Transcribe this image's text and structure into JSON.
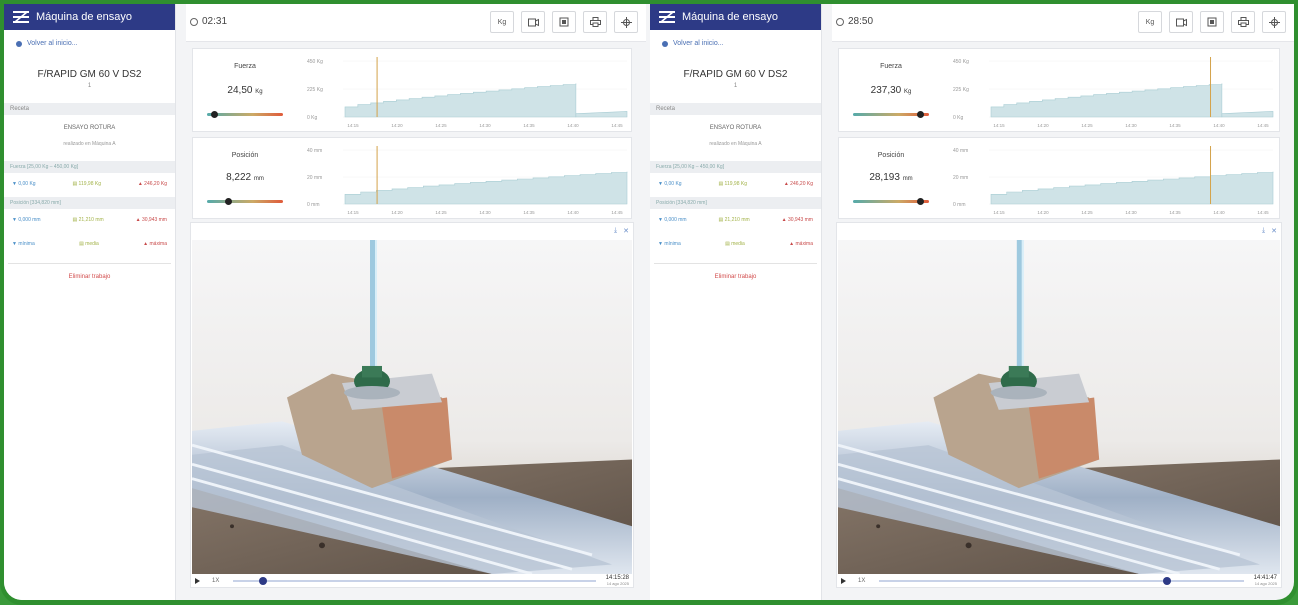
{
  "colors": {
    "header": "#2d3a86",
    "accent": "#4a6fb3",
    "chart_fill": "#cfe3e7",
    "marker": "#d4a24a",
    "delete": "#d24b4b",
    "frame": "#2f8f2f"
  },
  "panes": [
    {
      "sidebar": {
        "app_title": "Máquina de ensayo",
        "back_link": "Volver al inicio...",
        "product": "F/RAPID GM 60 V DS2",
        "product_sub": "1",
        "recipe_header": "Receta",
        "recipe_name": "ENSAYO ROTURA",
        "recipe_sub": "realizado en Máquina A",
        "force_header": "Fuerza [25,00 Kg – 450,00 Kg]",
        "force_values": [
          "▼ 0,00 Kg",
          "▤ 119,98 Kg",
          "▲ 246,20 Kg"
        ],
        "position_header": "Posición [334,820 mm]",
        "position_values": [
          "▼ 0,000 mm",
          "▤ 21,210 mm",
          "▲ 30,943 mm"
        ],
        "legend": [
          "▼ mínima",
          "▤ media",
          "▲ máxima"
        ],
        "delete": "Eliminar trabajo"
      },
      "timer": "02:31",
      "force": {
        "label": "Fuerza",
        "value": "24,50",
        "unit": "Kg",
        "level": 0.05
      },
      "position": {
        "label": "Posición",
        "value": "8,222",
        "unit": "mm",
        "level": 0.25
      },
      "player": {
        "speed": "1X",
        "progress": 0.07,
        "time": "14:15:28",
        "date": "14 ago 2025"
      },
      "force_chart": {
        "y_ticks": [
          "450 Kg",
          "225 Kg",
          "0 Kg"
        ],
        "x_ticks": [
          "14:15",
          "14:20",
          "14:25",
          "14:30",
          "14:35",
          "14:40",
          "14:45"
        ],
        "marker_frac": 0.12
      },
      "pos_chart": {
        "y_ticks": [
          "40 mm",
          "20 mm",
          "0 mm"
        ],
        "x_ticks": [
          "14:15",
          "14:20",
          "14:25",
          "14:30",
          "14:35",
          "14:40",
          "14:45"
        ],
        "marker_frac": 0.12
      }
    },
    {
      "sidebar": {
        "app_title": "Máquina de ensayo",
        "back_link": "Volver al inicio...",
        "product": "F/RAPID GM 60 V DS2",
        "product_sub": "1",
        "recipe_header": "Receta",
        "recipe_name": "ENSAYO ROTURA",
        "recipe_sub": "realizado en Máquina A",
        "force_header": "Fuerza [25,00 Kg – 450,00 Kg]",
        "force_values": [
          "▼ 0,00 Kg",
          "▤ 119,98 Kg",
          "▲ 246,20 Kg"
        ],
        "position_header": "Posición [334,820 mm]",
        "position_values": [
          "▼ 0,000 mm",
          "▤ 21,210 mm",
          "▲ 30,943 mm"
        ],
        "legend": [
          "▼ mínima",
          "▤ media",
          "▲ máxima"
        ],
        "delete": "Eliminar trabajo"
      },
      "timer": "28:50",
      "force": {
        "label": "Fuerza",
        "value": "237,30",
        "unit": "Kg",
        "level": 0.92
      },
      "position": {
        "label": "Posición",
        "value": "28,193",
        "unit": "mm",
        "level": 0.92
      },
      "player": {
        "speed": "1X",
        "progress": 0.78,
        "time": "14:41:47",
        "date": "14 ago 2025"
      },
      "force_chart": {
        "y_ticks": [
          "450 Kg",
          "225 Kg",
          "0 Kg"
        ],
        "x_ticks": [
          "14:15",
          "14:20",
          "14:25",
          "14:30",
          "14:35",
          "14:40",
          "14:45"
        ],
        "marker_frac": 0.78
      },
      "pos_chart": {
        "y_ticks": [
          "40 mm",
          "20 mm",
          "0 mm"
        ],
        "x_ticks": [
          "14:15",
          "14:20",
          "14:25",
          "14:30",
          "14:35",
          "14:40",
          "14:45"
        ],
        "marker_frac": 0.78
      }
    }
  ],
  "toolbar": [
    "Kg",
    "video-icon",
    "screenshot-icon",
    "print-icon",
    "crosshair-icon"
  ]
}
